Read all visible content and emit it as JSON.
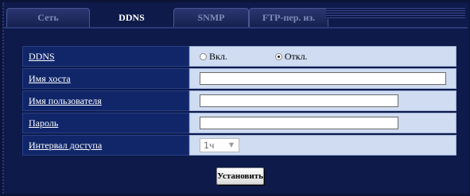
{
  "tabs": [
    {
      "label": "Сеть",
      "active": false
    },
    {
      "label": "DDNS",
      "active": true
    },
    {
      "label": "SNMP",
      "active": false
    },
    {
      "label": "FTP-пер. из.",
      "active": false
    }
  ],
  "form": {
    "ddns": {
      "label": "DDNS",
      "on_label": "Вкл.",
      "off_label": "Откл.",
      "selected": "off"
    },
    "hostname": {
      "label": "Имя хоста",
      "value": ""
    },
    "username": {
      "label": "Имя пользователя",
      "value": ""
    },
    "password": {
      "label": "Пароль",
      "value": ""
    },
    "interval": {
      "label": "Интервал доступа",
      "value": "1ч"
    }
  },
  "buttons": {
    "set_label": "Установить"
  },
  "colors": {
    "background": "#0d1a4a",
    "label_bg": "#102669",
    "value_bg": "#cfdcf1"
  }
}
